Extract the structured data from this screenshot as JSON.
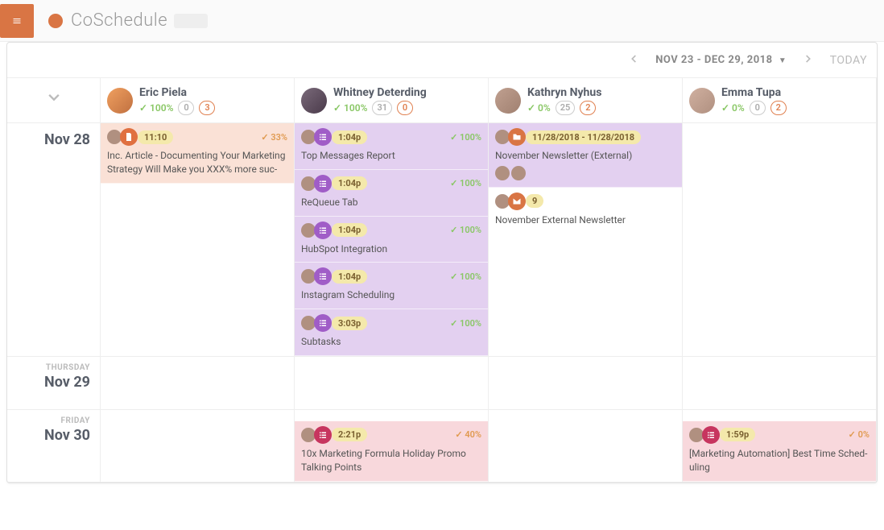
{
  "brand": "CoSchedule",
  "toolbar": {
    "date_range": "NOV 23 - DEC 29, 2018",
    "today": "TODAY"
  },
  "columns": [
    {
      "name": "Eric Piela",
      "pct": "100%",
      "count1": "0",
      "count2": "3"
    },
    {
      "name": "Whitney Deterding",
      "pct": "100%",
      "count1": "31",
      "count2": "0"
    },
    {
      "name": "Kathryn Nyhus",
      "pct": "0%",
      "count1": "25",
      "count2": "2"
    },
    {
      "name": "Emma Tupa",
      "pct": "0%",
      "count1": "0",
      "count2": "2"
    }
  ],
  "rows": [
    {
      "dow": "",
      "label": "Nov 28"
    },
    {
      "dow": "THURSDAY",
      "label": "Nov 29"
    },
    {
      "dow": "FRIDAY",
      "label": "Nov 30"
    }
  ],
  "cards": {
    "eric_28": {
      "time": "11:10",
      "pct": "33%",
      "title": "Inc. Article - Documenting Your Marketing Strategy Will Make you XXX% more suc-"
    },
    "whit_28a": {
      "time": "1:04p",
      "pct": "100%",
      "title": "Top Messages Report"
    },
    "whit_28b": {
      "time": "1:04p",
      "pct": "100%",
      "title": "ReQueue Tab"
    },
    "whit_28c": {
      "time": "1:04p",
      "pct": "100%",
      "title": "HubSpot Integration"
    },
    "whit_28d": {
      "time": "1:04p",
      "pct": "100%",
      "title": "Instagram Scheduling"
    },
    "whit_28e": {
      "time": "3:03p",
      "pct": "100%",
      "title": "Subtasks"
    },
    "kath_28a": {
      "time": "11/28/2018 - 11/28/2018",
      "title": "November Newsletter (External)"
    },
    "kath_28b": {
      "time": "9",
      "title": "November External Newsletter"
    },
    "whit_30": {
      "time": "2:21p",
      "pct": "40%",
      "title": "10x Marketing Formula Holiday Promo Talking Points"
    },
    "emma_30": {
      "time": "1:59p",
      "pct": "0%",
      "title": "[Marketing Automation] Best Time Sched-uling"
    }
  }
}
